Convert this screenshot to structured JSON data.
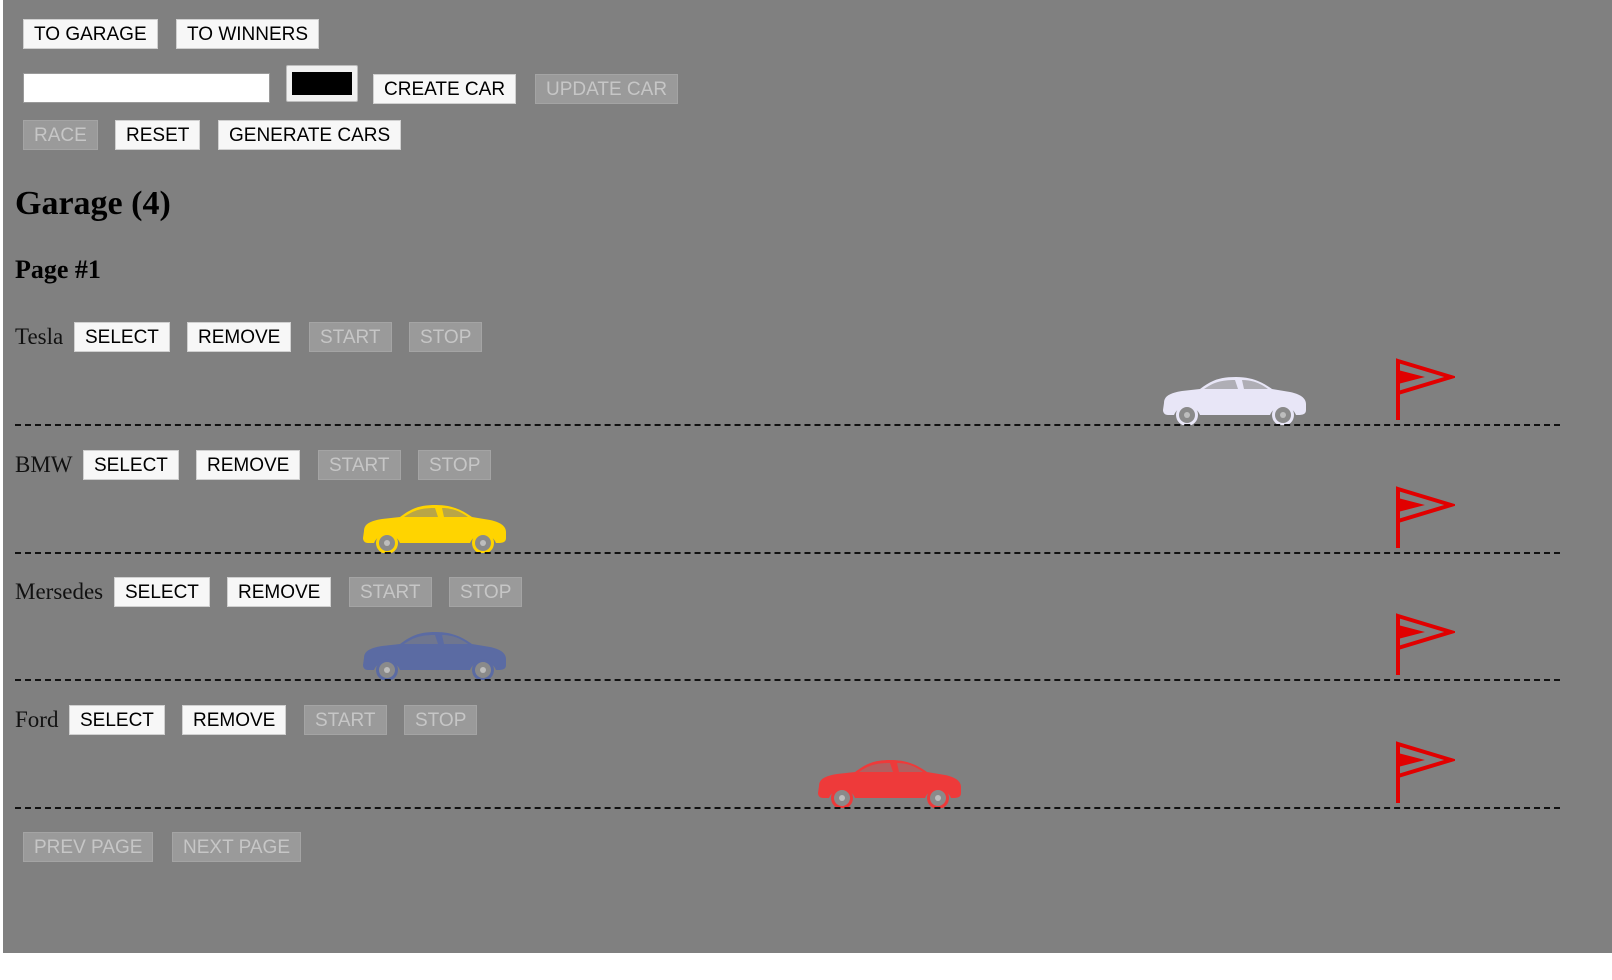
{
  "nav": {
    "garage_label": "TO GARAGE",
    "winners_label": "TO WINNERS"
  },
  "form": {
    "name_value": "",
    "color_value": "#000000",
    "create_label": "CREATE CAR",
    "update_label": "UPDATE CAR"
  },
  "controls": {
    "race_label": "RACE",
    "reset_label": "RESET",
    "generate_label": "GENERATE CARS"
  },
  "garage": {
    "title": "Garage (4)",
    "page": "Page #1"
  },
  "car_actions": {
    "select": "SELECT",
    "remove": "REMOVE",
    "start": "START",
    "stop": "STOP"
  },
  "cars": [
    {
      "name": "Tesla",
      "color": "#e8e6f7",
      "icon": "car-icon",
      "progress": 0.83
    },
    {
      "name": "BMW",
      "color": "#ffd400",
      "icon": "car-icon",
      "progress": 0.25
    },
    {
      "name": "Mersedes",
      "color": "#5b6ba3",
      "icon": "car-icon",
      "progress": 0.25
    },
    {
      "name": "Ford",
      "color": "#ee3a3a",
      "icon": "car-icon",
      "progress": 0.58
    }
  ],
  "finish_flag": {
    "icon": "flag-icon",
    "color": "#e10000"
  },
  "pagination": {
    "prev_label": "PREV PAGE",
    "next_label": "NEXT PAGE"
  }
}
